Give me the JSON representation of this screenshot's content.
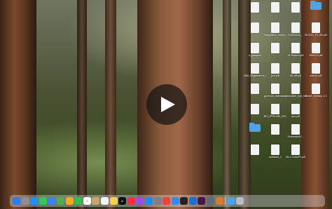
{
  "wallpaper": {
    "name": "forest-redwoods"
  },
  "video": {
    "play_icon": "play-icon"
  },
  "desktop_icons": [
    {
      "label": "",
      "kind": "doc"
    },
    {
      "label": "",
      "kind": "doc"
    },
    {
      "label": "a_passport",
      "kind": "doc"
    },
    {
      "label": "NBA_Registrations_Passport.pdf",
      "kind": "doc"
    },
    {
      "label": "",
      "kind": "doc"
    },
    {
      "label": "",
      "kind": "doc"
    },
    {
      "label": "",
      "kind": "folder"
    },
    {
      "label": "",
      "kind": "doc"
    },
    {
      "label": "",
      "kind": "doc"
    },
    {
      "label": "integrations_lecture_trial_assessment",
      "kind": "doc"
    },
    {
      "label": "",
      "kind": "doc"
    },
    {
      "label": "port.pdf",
      "kind": "doc"
    },
    {
      "label": "governor_assistance",
      "kind": "doc"
    },
    {
      "label": "BIO_PRELIMS_2024_...",
      "kind": "doc"
    },
    {
      "label": "",
      "kind": "doc"
    },
    {
      "label": "assistant_1",
      "kind": "doc"
    },
    {
      "label": "",
      "kind": "doc"
    },
    {
      "label": "100043443_...",
      "kind": "doc"
    },
    {
      "label": "14 Reason.pdf",
      "kind": "doc"
    },
    {
      "label": "tax-bill.pdf",
      "kind": "doc"
    },
    {
      "label": "automation_tool_trial_assessment",
      "kind": "doc"
    },
    {
      "label": "qua.pdf",
      "kind": "doc"
    },
    {
      "label": "ScreenshotX...",
      "kind": "doc"
    },
    {
      "label": "file.1-LeavePr.pdf",
      "kind": "doc"
    },
    {
      "label": "",
      "kind": "folder"
    },
    {
      "label": "BLOOD_TR_Bill.pdf",
      "kind": "doc"
    },
    {
      "label": "Wire123.pdf",
      "kind": "doc"
    },
    {
      "label": "policy1.pdf",
      "kind": "doc"
    },
    {
      "label": "Wazer_Desktop 1-2",
      "kind": "doc"
    }
  ],
  "dock": {
    "items": [
      {
        "name": "finder-icon",
        "color": "#2b7de9"
      },
      {
        "name": "launchpad-icon",
        "color": "#8a8f99"
      },
      {
        "name": "safari-icon",
        "color": "#1e90ff"
      },
      {
        "name": "messages-icon",
        "color": "#34c759"
      },
      {
        "name": "mail-icon",
        "color": "#3b82f6"
      },
      {
        "name": "maps-icon",
        "color": "#4caf50"
      },
      {
        "name": "photos-icon",
        "color": "#f5a623"
      },
      {
        "name": "facetime-icon",
        "color": "#2fbf4a"
      },
      {
        "name": "calendar-icon",
        "color": "#ffffff",
        "text": "2"
      },
      {
        "name": "contacts-icon",
        "color": "#c9a46b"
      },
      {
        "name": "reminders-icon",
        "color": "#f2f2f2"
      },
      {
        "name": "notes-icon",
        "color": "#f7d046"
      },
      {
        "name": "apple-tv-icon",
        "color": "#111111",
        "text": "tv"
      },
      {
        "name": "music-icon",
        "color": "#fa2d48"
      },
      {
        "name": "podcasts-icon",
        "color": "#9b4de6"
      },
      {
        "name": "app-store-icon",
        "color": "#1c8cf0"
      },
      {
        "name": "system-settings-icon",
        "color": "#7d7f86"
      },
      {
        "name": "chrome-icon",
        "color": "#e8453c"
      },
      {
        "name": "zoom-icon",
        "color": "#2d8cff"
      },
      {
        "name": "terminal-icon",
        "color": "#222222"
      },
      {
        "name": "vscode-icon",
        "color": "#1f6fd1"
      },
      {
        "name": "slack-icon",
        "color": "#4a154b"
      },
      {
        "name": "preview-icon",
        "color": "#5d6b7a"
      },
      {
        "name": "app-icon",
        "color": "#d97b2b"
      }
    ],
    "trailing": [
      {
        "name": "downloads-folder-icon",
        "color": "#4aa3e8"
      },
      {
        "name": "trash-icon",
        "color": "#b8bcc4"
      }
    ]
  }
}
